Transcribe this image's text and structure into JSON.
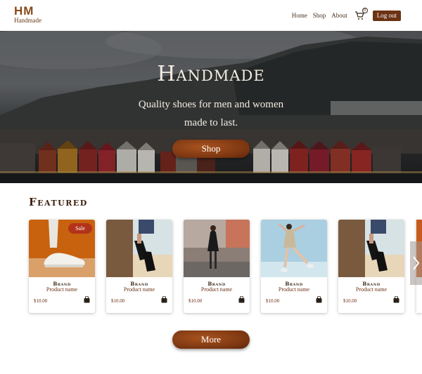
{
  "logo": {
    "mark": "HM",
    "subtitle": "Handmade"
  },
  "nav": {
    "items": [
      "Home",
      "Shop",
      "About"
    ],
    "cart_icon": "cart-icon",
    "cart_count": "0",
    "logout_label": "Log out"
  },
  "hero": {
    "title": "Handmade",
    "subtitle": "Quality shoes for men and women made to last.",
    "cta_label": "Shop"
  },
  "featured": {
    "heading": "Featured",
    "products": [
      {
        "brand": "Brand",
        "name": "Product name",
        "price": "$10.00",
        "badge": "Sale",
        "image": "white-sneaker-on-orange"
      },
      {
        "brand": "Brand",
        "name": "Product name",
        "price": "$10.00",
        "badge": "",
        "image": "black-heels-on-beach"
      },
      {
        "brand": "Brand",
        "name": "Product name",
        "price": "$10.00",
        "badge": "",
        "image": "woman-black-dress-walking"
      },
      {
        "brand": "Brand",
        "name": "Product name",
        "price": "$10.00",
        "badge": "",
        "image": "woman-jumping-sky"
      },
      {
        "brand": "Brand",
        "name": "Product name",
        "price": "$10.00",
        "badge": "",
        "image": "black-heels-on-beach"
      }
    ],
    "next_icon": "chevron-right-icon",
    "more_label": "More"
  },
  "colors": {
    "brand": "#6b3214",
    "accent": "#8a4a1c",
    "sale": "#b3321a"
  }
}
